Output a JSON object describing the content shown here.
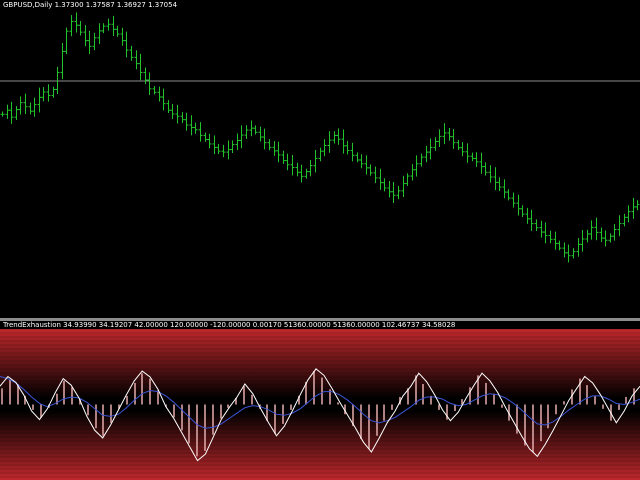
{
  "main_pane": {
    "symbol_label": "GBPUSD,Daily",
    "ohlc_label": "1.37300 1.37587 1.36927 1.37054",
    "bar_color": "#22c22a",
    "level_line_color": "#8c8c8c"
  },
  "indicator_pane": {
    "label": "TrendExhaustion 34.93990 34.19207 42.00000 120.00000 -120.00000 0.00170 51360.00000 51360.00000 102.46737 34.58028",
    "line_main_color": "#ffffff",
    "line_signal_color": "#3b56d6",
    "histogram_color": "#d9a3a3",
    "band_color": "#c0282c"
  },
  "chart_data": [
    {
      "type": "bar",
      "series": [
        {
          "values": [
            1.3588,
            1.3601,
            1.3579,
            1.3603,
            1.3625,
            1.3612,
            1.3598,
            1.3619,
            1.3642,
            1.3659,
            1.3648,
            1.3667,
            1.3721,
            1.3788,
            1.3852,
            1.3883,
            1.3871,
            1.3849,
            1.3822,
            1.3804,
            1.3831,
            1.3853,
            1.3868,
            1.3874,
            1.3858,
            1.3843,
            1.3822,
            1.3792,
            1.3769,
            1.3749,
            1.3721,
            1.3697,
            1.3669,
            1.3658,
            1.3643,
            1.3622,
            1.3601,
            1.3589,
            1.3582,
            1.3571,
            1.3554,
            1.3546,
            1.3539,
            1.3521,
            1.3508,
            1.3494,
            1.3483,
            1.3471,
            1.3468,
            1.3476,
            1.3492,
            1.3505,
            1.3522,
            1.3538,
            1.3544,
            1.3531,
            1.3516,
            1.3498,
            1.3483,
            1.3472,
            1.3459,
            1.3441,
            1.3428,
            1.3419,
            1.3404,
            1.3391,
            1.3406,
            1.3425,
            1.3448,
            1.3471,
            1.3489,
            1.3506,
            1.3521,
            1.3509,
            1.3488,
            1.3473,
            1.3458,
            1.3443,
            1.3431,
            1.3418,
            1.3402,
            1.3386,
            1.3371,
            1.3354,
            1.3342,
            1.3331,
            1.3345,
            1.3368,
            1.3392,
            1.3412,
            1.3431,
            1.3452,
            1.3468,
            1.3483,
            1.3502,
            1.3518,
            1.3529,
            1.3517,
            1.3498,
            1.3482,
            1.3469,
            1.3455,
            1.3448,
            1.3437,
            1.3422,
            1.3404,
            1.3389,
            1.3372,
            1.3357,
            1.3341,
            1.3322,
            1.3306,
            1.3288,
            1.3271,
            1.3256,
            1.3241,
            1.3228,
            1.3214,
            1.3203,
            1.3191,
            1.3178,
            1.3163,
            1.3148,
            1.3139,
            1.3152,
            1.3175,
            1.3192,
            1.3208,
            1.3229,
            1.3213,
            1.3195,
            1.3188,
            1.3201,
            1.3222,
            1.3241,
            1.3261,
            1.3279,
            1.3294,
            1.3302
          ],
          "ohlc_last": {
            "open": 1.373,
            "high": 1.37587,
            "low": 1.36927,
            "close": 1.37054
          }
        }
      ]
    },
    {
      "type": "line",
      "series": [
        {
          "values": [
            34.0,
            52.0,
            41.0,
            18.0,
            -12.0,
            -28.0,
            -8.0,
            22.0,
            48.0,
            36.0,
            12.0,
            -22.0,
            -48.0,
            -62.0,
            -38.0,
            -10.0,
            18.0,
            44.0,
            62.0,
            51.0,
            28.0,
            -4.0,
            -26.0,
            -52.0,
            -78.0,
            -104.0,
            -92.0,
            -60.0,
            -28.0,
            -6.0,
            14.0,
            38.0,
            20.0,
            -8.0,
            -34.0,
            -58.0,
            -40.0,
            -12.0,
            18.0,
            46.0,
            66.0,
            54.0,
            30.0,
            4.0,
            -20.0,
            -44.0,
            -70.0,
            -88.0,
            -62.0,
            -34.0,
            -12.0,
            16.0,
            34.0,
            58.0,
            42.0,
            18.0,
            -10.0,
            -30.0,
            -14.0,
            12.0,
            36.0,
            58.0,
            44.0,
            22.0,
            -6.0,
            -32.0,
            -58.0,
            -82.0,
            -96.0,
            -74.0,
            -48.0,
            -20.0,
            8.0,
            30.0,
            52.0,
            40.0,
            18.0,
            -8.0,
            -34.0,
            -12.0,
            16.0,
            34.0
          ]
        },
        {
          "values": [
            52.0,
            48.0,
            40.0,
            28.0,
            14.0,
            2.0,
            -4.0,
            2.0,
            10.0,
            14.0,
            12.0,
            4.0,
            -8.0,
            -20.0,
            -22.0,
            -18.0,
            -6.0,
            8.0,
            20.0,
            26.0,
            24.0,
            16.0,
            4.0,
            -10.0,
            -24.0,
            -38.0,
            -44.0,
            -42.0,
            -36.0,
            -26.0,
            -16.0,
            -6.0,
            -2.0,
            -4.0,
            -10.0,
            -18.0,
            -20.0,
            -16.0,
            -8.0,
            4.0,
            16.0,
            24.0,
            24.0,
            18.0,
            8.0,
            -4.0,
            -18.0,
            -30.0,
            -34.0,
            -30.0,
            -24.0,
            -14.0,
            -4.0,
            8.0,
            14.0,
            14.0,
            10.0,
            2.0,
            -2.0,
            0.0,
            8.0,
            16.0,
            20.0,
            18.0,
            12.0,
            2.0,
            -10.0,
            -24.0,
            -36.0,
            -38.0,
            -32.0,
            -22.0,
            -10.0,
            0.0,
            10.0,
            16.0,
            16.0,
            10.0,
            2.0,
            0.0,
            4.0,
            10.0
          ]
        }
      ],
      "histogram": [
        30.0,
        46.0,
        38.0,
        16.0,
        -10.0,
        -24.0,
        -6.0,
        20.0,
        44.0,
        32.0,
        10.0,
        -20.0,
        -44.0,
        -58.0,
        -34.0,
        -8.0,
        16.0,
        40.0,
        58.0,
        48.0,
        26.0,
        -4.0,
        -24.0,
        -48.0,
        -72.0,
        -96.0,
        -86.0,
        -56.0,
        -26.0,
        -6.0,
        12.0,
        34.0,
        18.0,
        -8.0,
        -30.0,
        -54.0,
        -36.0,
        -10.0,
        16.0,
        42.0,
        62.0,
        50.0,
        28.0,
        4.0,
        -18.0,
        -40.0,
        -64.0,
        -82.0,
        -58.0,
        -30.0,
        -10.0,
        14.0,
        30.0,
        54.0,
        38.0,
        16.0,
        -10.0,
        -28.0,
        -12.0,
        10.0,
        32.0,
        54.0,
        40.0,
        20.0,
        -6.0,
        -30.0,
        -54.0,
        -76.0,
        -88.0,
        -68.0,
        -44.0,
        -18.0,
        6.0,
        28.0,
        48.0,
        36.0,
        16.0,
        -8.0,
        -30.0,
        -10.0,
        14.0,
        30.0
      ],
      "levels": [
        120.0,
        -120.0
      ],
      "ylim": [
        -140.0,
        140.0
      ]
    }
  ]
}
